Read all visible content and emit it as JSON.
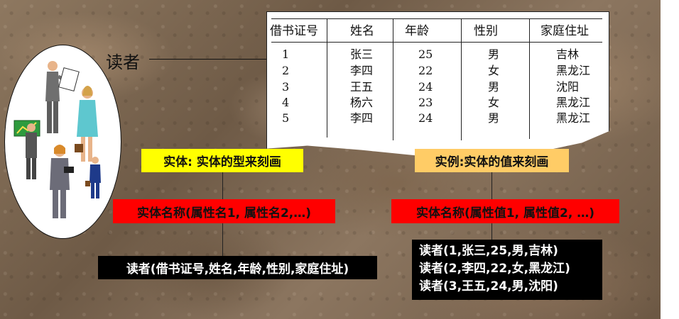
{
  "reader_label": "读者",
  "table": {
    "headers": [
      "借书证号",
      "姓名",
      "年龄",
      "性别",
      "家庭住址"
    ],
    "rows": [
      [
        "1",
        "张三",
        "25",
        "男",
        "吉林"
      ],
      [
        "2",
        "李四",
        "22",
        "女",
        "黑龙江"
      ],
      [
        "3",
        "王五",
        "24",
        "男",
        "沈阳"
      ],
      [
        "4",
        "杨六",
        "23",
        "女",
        "黑龙江"
      ],
      [
        "5",
        "李四",
        "24",
        "男",
        "黑龙江"
      ]
    ]
  },
  "entity": {
    "label": "实体: 实体的型来刻画",
    "format": "实体名称(属性名1, 属性名2,…)",
    "example": "读者(借书证号,姓名,年龄,性别,家庭住址)"
  },
  "instance": {
    "label": "实例:实体的值来刻画",
    "format": "实体名称(属性值1, 属性值2, …)",
    "examples": [
      "读者(1,张三,25,男,吉林)",
      "读者(2,李四,22,女,黑龙江)",
      "读者(3,王五,24,男,沈阳)"
    ]
  }
}
